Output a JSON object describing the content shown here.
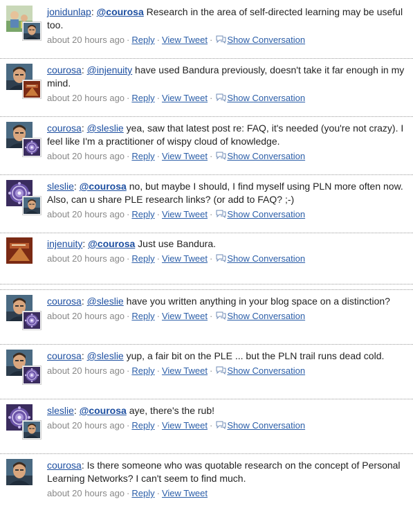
{
  "tweets": [
    {
      "avatar_big": "jonidunlap",
      "avatar_small": "courosa",
      "user": "jonidunlap",
      "sep": ": ",
      "mention": "@courosa",
      "mention_bold": true,
      "text": " Research in the area of self-directed learning may be useful too.",
      "time": "about 20 hours ago",
      "reply": "Reply",
      "view": "View Tweet",
      "conversation": "Show Conversation",
      "has_conversation": true
    },
    {
      "avatar_big": "courosa",
      "avatar_small": "injenuity",
      "user": "courosa",
      "sep": ": ",
      "mention": "@injenuity",
      "mention_bold": false,
      "text": " have used Bandura previously, doesn't take it far enough in my mind.",
      "time": "about 20 hours ago",
      "reply": "Reply",
      "view": "View Tweet",
      "conversation": "Show Conversation",
      "has_conversation": true
    },
    {
      "avatar_big": "courosa",
      "avatar_small": "sleslie",
      "user": "courosa",
      "sep": ": ",
      "mention": "@sleslie",
      "mention_bold": false,
      "text": " yea, saw that latest post re: FAQ, it's needed (you're not crazy). I feel like I'm a practitioner of wispy cloud of knowledge.",
      "time": "about 20 hours ago",
      "reply": "Reply",
      "view": "View Tweet",
      "conversation": "Show Conversation",
      "has_conversation": true
    },
    {
      "avatar_big": "sleslie",
      "avatar_small": "courosa",
      "user": "sleslie",
      "sep": ": ",
      "mention": "@courosa",
      "mention_bold": true,
      "text": " no, but maybe I should, I find myself using PLN more often now. Also, can u share PLE research links? (or add to FAQ? ;-)",
      "time": "about 20 hours ago",
      "reply": "Reply",
      "view": "View Tweet",
      "conversation": "Show Conversation",
      "has_conversation": true
    },
    {
      "avatar_big": "injenuity",
      "avatar_small": "",
      "user": "injenuity",
      "sep": ": ",
      "mention": "@courosa",
      "mention_bold": true,
      "text": " Just use Bandura.",
      "time": "about 20 hours ago",
      "reply": "Reply",
      "view": "View Tweet",
      "conversation": "Show Conversation",
      "has_conversation": true
    },
    {
      "avatar_big": "courosa",
      "avatar_small": "sleslie",
      "user": "courosa",
      "sep": ": ",
      "mention": "@sleslie",
      "mention_bold": false,
      "text": " have you written anything in your blog space on a distinction?",
      "time": "about 20 hours ago",
      "reply": "Reply",
      "view": "View Tweet",
      "conversation": "Show Conversation",
      "has_conversation": true
    },
    {
      "avatar_big": "courosa",
      "avatar_small": "sleslie",
      "user": "courosa",
      "sep": ": ",
      "mention": "@sleslie",
      "mention_bold": false,
      "text": " yup, a fair bit on the PLE ... but the PLN trail runs dead cold.",
      "time": "about 20 hours ago",
      "reply": "Reply",
      "view": "View Tweet",
      "conversation": "Show Conversation",
      "has_conversation": true
    },
    {
      "avatar_big": "sleslie",
      "avatar_small": "courosa",
      "user": "sleslie",
      "sep": ": ",
      "mention": "@courosa",
      "mention_bold": true,
      "text": " aye, there's the rub!",
      "time": "about 20 hours ago",
      "reply": "Reply",
      "view": "View Tweet",
      "conversation": "Show Conversation",
      "has_conversation": true
    },
    {
      "avatar_big": "courosa",
      "avatar_small": "",
      "user": "courosa",
      "sep": ": ",
      "mention": "",
      "mention_bold": false,
      "text": "Is there someone who was quotable research on the concept of Personal Learning Networks? I can't seem to find much.",
      "time": "about 20 hours ago",
      "reply": "Reply",
      "view": "View Tweet",
      "conversation": "",
      "has_conversation": false
    }
  ]
}
